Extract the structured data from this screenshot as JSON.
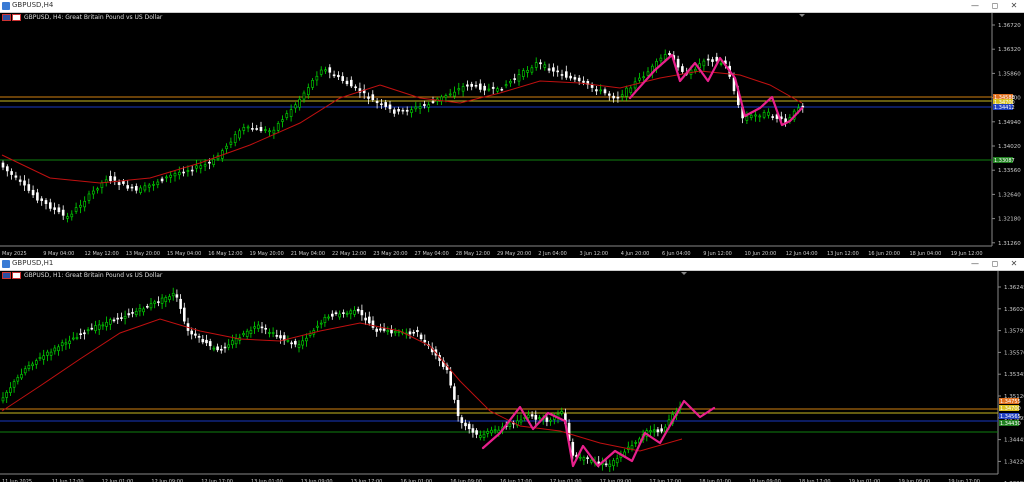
{
  "top": {
    "window_title": "GBPUSD,H4",
    "symbol_line": "GBPUSD, H4:  Great Britain Pound vs US Dollar",
    "price_labels": [
      "1.36720",
      "1.36320",
      "1.35860",
      "1.35400",
      "1.34940",
      "1.34020",
      "1.33560",
      "1.32640",
      "1.32180",
      "1.31260"
    ],
    "tag_labels": [
      {
        "text": "1.34588",
        "bg": "#e07020"
      },
      {
        "text": "1.34700",
        "bg": "#d8c020"
      },
      {
        "text": "1.34412",
        "bg": "#2040c0"
      },
      {
        "text": "1.33087",
        "bg": "#208020"
      }
    ],
    "time_labels": [
      "May 2025",
      "9 May 04:00",
      "12 May 12:00",
      "13 May 20:00",
      "15 May 04:00",
      "16 May 12:00",
      "19 May 20:00",
      "21 May 04:00",
      "22 May 12:00",
      "23 May 20:00",
      "27 May 04:00",
      "28 May 12:00",
      "29 May 20:00",
      "2 Jun 04:00",
      "3 Jun 12:00",
      "4 Jun 20:00",
      "6 Jun 04:00",
      "9 Jun 12:00",
      "10 Jun 20:00",
      "12 Jun 04:00",
      "13 Jun 12:00",
      "16 Jun 20:00",
      "18 Jun 04:00",
      "19 Jun 12:00"
    ]
  },
  "bottom": {
    "window_title": "GBPUSD,H1",
    "symbol_line": "GBPUSD, H1:  Great Britain Pound vs US Dollar",
    "price_labels": [
      "1.36245",
      "1.36020",
      "1.35795",
      "1.35570",
      "1.35345",
      "1.35120",
      "1.34895",
      "1.34445",
      "1.34220",
      "1.33995"
    ],
    "tag_labels": [
      {
        "text": "1.34755",
        "bg": "#e07020"
      },
      {
        "text": "1.34700",
        "bg": "#d8c020"
      },
      {
        "text": "1.34565",
        "bg": "#2040c0"
      },
      {
        "text": "1.34430",
        "bg": "#208020"
      }
    ],
    "time_labels": [
      "11 Jun 2025",
      "11 Jun 17:00",
      "12 Jun 01:00",
      "12 Jun 09:00",
      "12 Jun 17:00",
      "13 Jun 01:00",
      "13 Jun 09:00",
      "13 Jun 17:00",
      "16 Jun 01:00",
      "16 Jun 09:00",
      "16 Jun 17:00",
      "17 Jun 01:00",
      "17 Jun 09:00",
      "17 Jun 17:00",
      "18 Jun 01:00",
      "18 Jun 09:00",
      "18 Jun 17:00",
      "19 Jun 01:00",
      "19 Jun 09:00",
      "19 Jun 17:00"
    ]
  },
  "colors": {
    "bull": "#00e000",
    "bear": "#ffffff",
    "ma": "#c01010",
    "pattern": "#e8208c",
    "hline_orange": "#d08010",
    "hline_yellow": "#c8b820",
    "hline_blue": "#1838c0",
    "hline_green": "#108010"
  }
}
